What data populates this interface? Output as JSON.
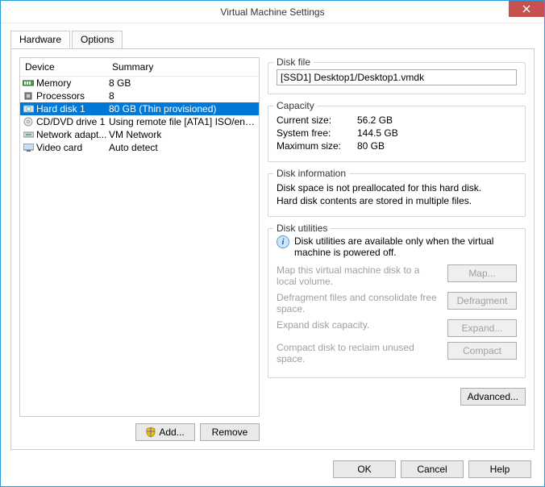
{
  "window": {
    "title": "Virtual Machine Settings"
  },
  "tabs": {
    "hardware": "Hardware",
    "options": "Options"
  },
  "list": {
    "header_device": "Device",
    "header_summary": "Summary",
    "rows": [
      {
        "device": "Memory",
        "summary": "8 GB"
      },
      {
        "device": "Processors",
        "summary": "8"
      },
      {
        "device": "Hard disk 1",
        "summary": "80 GB (Thin provisioned)"
      },
      {
        "device": "CD/DVD drive 1",
        "summary": "Using remote file [ATA1] ISO/en_..."
      },
      {
        "device": "Network adapt...",
        "summary": "VM Network"
      },
      {
        "device": "Video card",
        "summary": "Auto detect"
      }
    ]
  },
  "left_buttons": {
    "add": "Add...",
    "remove": "Remove"
  },
  "disk_file": {
    "title": "Disk file",
    "value": "[SSD1] Desktop1/Desktop1.vmdk"
  },
  "capacity": {
    "title": "Capacity",
    "current_label": "Current size:",
    "current_value": "56.2 GB",
    "system_label": "System free:",
    "system_value": "144.5 GB",
    "max_label": "Maximum size:",
    "max_value": "80 GB"
  },
  "disk_info": {
    "title": "Disk information",
    "line1": "Disk space is not preallocated for this hard disk.",
    "line2": "Hard disk contents are stored in multiple files."
  },
  "utilities": {
    "title": "Disk utilities",
    "notice": "Disk utilities are available only when the virtual machine is powered off.",
    "map_text": "Map this virtual machine disk to a local volume.",
    "map_btn": "Map...",
    "defrag_text": "Defragment files and consolidate free space.",
    "defrag_btn": "Defragment",
    "expand_text": "Expand disk capacity.",
    "expand_btn": "Expand...",
    "compact_text": "Compact disk to reclaim unused space.",
    "compact_btn": "Compact"
  },
  "advanced": "Advanced...",
  "footer": {
    "ok": "OK",
    "cancel": "Cancel",
    "help": "Help"
  }
}
